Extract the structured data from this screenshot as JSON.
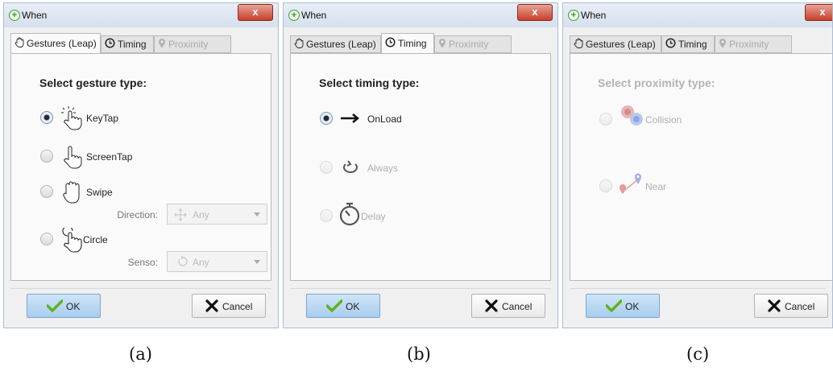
{
  "window_title": "When",
  "close_label": "x",
  "tabs": {
    "gestures": "Gestures (Leap)",
    "timing": "Timing",
    "proximity": "Proximity"
  },
  "buttons": {
    "ok": "OK",
    "cancel": "Cancel"
  },
  "panel_a": {
    "heading": "Select gesture type:",
    "options": [
      "KeyTap",
      "ScreenTap",
      "Swipe",
      "Circle"
    ],
    "selected": "KeyTap",
    "direction_label": "Direction:",
    "direction_value": "Any",
    "senso_label": "Senso:",
    "senso_value": "Any"
  },
  "panel_b": {
    "heading": "Select timing type:",
    "options": [
      "OnLoad",
      "Always",
      "Delay"
    ],
    "selected": "OnLoad"
  },
  "panel_c": {
    "heading": "Select proximity type:",
    "options": [
      "Collision",
      "Near"
    ]
  },
  "captions": [
    "(a)",
    "(b)",
    "(c)"
  ],
  "icons": {
    "title": "plus-circle-icon",
    "hand": "hand-icon",
    "clock": "clock-icon",
    "pin": "location-pin-icon",
    "check": "check-icon",
    "cross": "cross-icon"
  },
  "colors": {
    "accent": "#5b8fcf",
    "ok_button": "#b7d5f2",
    "close_button": "#c7402b",
    "check": "#5fb320"
  }
}
